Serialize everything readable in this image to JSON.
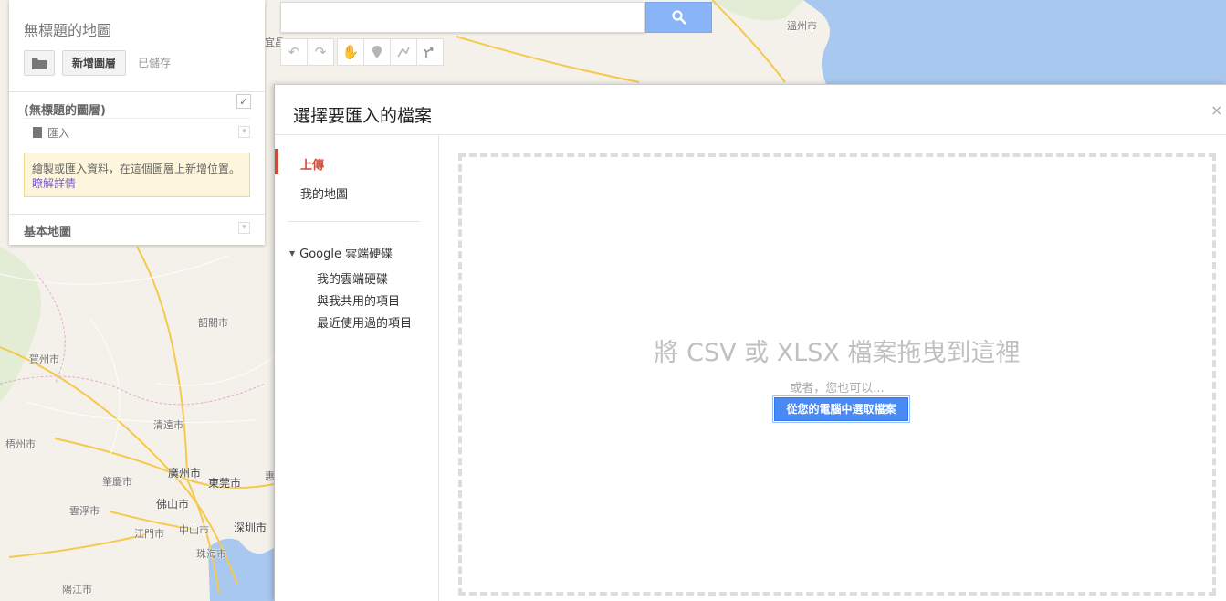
{
  "map": {
    "labels": [
      "溫州市",
      "宜昌",
      "韶關市",
      "賀州市",
      "清遠市",
      "梧州市",
      "肇慶市",
      "廣州市",
      "東莞市",
      "惠",
      "佛山市",
      "雲浮市",
      "江門市",
      "中山市",
      "深圳市",
      "珠海市",
      "陽江市"
    ],
    "colors": {
      "land": "#f4f1ea",
      "water": "#a8c8f0",
      "road": "#f5c94d"
    }
  },
  "search": {
    "placeholder": "",
    "button_icon": "search-icon"
  },
  "toolbar": {
    "icons": [
      "undo-icon",
      "redo-icon",
      "hand-icon",
      "marker-icon",
      "line-icon",
      "directions-icon"
    ]
  },
  "left_panel": {
    "map_title": "無標題的地圖",
    "add_layer_label": "新增圖層",
    "saved_status": "已儲存",
    "layer": {
      "name": "(無標題的圖層)",
      "import_label": "匯入",
      "hint_text": "繪製或匯入資料，在這個圖層上新增位置。",
      "hint_link": "瞭解詳情"
    },
    "basemap_label": "基本地圖"
  },
  "dialog": {
    "title": "選擇要匯入的檔案",
    "close": "×",
    "nav": {
      "upload": "上傳",
      "my_maps": "我的地圖",
      "drive": "Google 雲端硬碟",
      "drive_items": [
        "我的雲端硬碟",
        "與我共用的項目",
        "最近使用過的項目"
      ]
    },
    "drop_text": "將 CSV 或 XLSX 檔案拖曳到這裡",
    "or_text": "或者，您也可以...",
    "choose_button": "從您的電腦中選取檔案",
    "accent": "#d14836",
    "button_color": "#4a8af4"
  }
}
